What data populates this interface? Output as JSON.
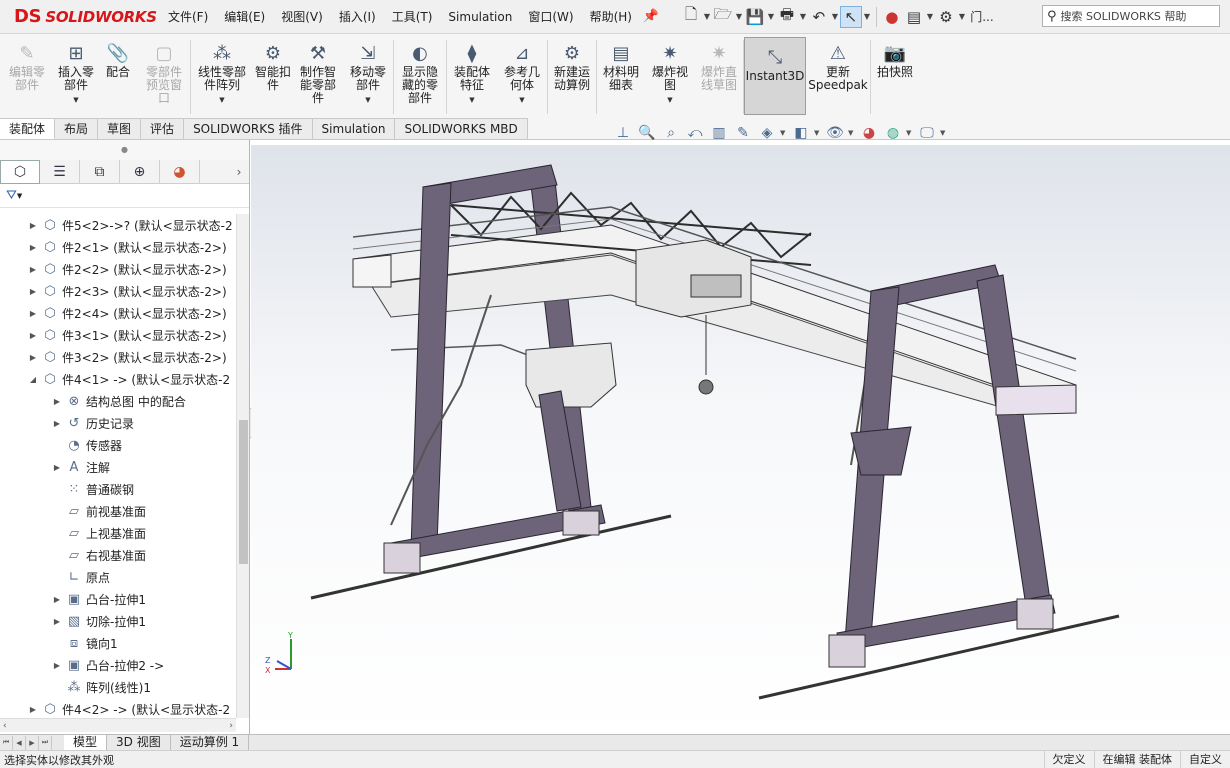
{
  "app": {
    "brand_mark": "DS",
    "brand": "SOLIDWORKS"
  },
  "menus": [
    "文件(F)",
    "编辑(E)",
    "视图(V)",
    "插入(I)",
    "工具(T)",
    "Simulation",
    "窗口(W)",
    "帮助(H)"
  ],
  "search": {
    "placeholder": "搜索 SOLIDWORKS 帮助"
  },
  "quick_access": {
    "overflow_label": "门..."
  },
  "ribbon": [
    {
      "label": "编辑零\n部件",
      "icon": "edit-component-icon",
      "disabled": true
    },
    {
      "label": "插入零\n部件",
      "icon": "insert-component-icon",
      "dropdown": true
    },
    {
      "label": "配合",
      "icon": "mate-icon"
    },
    {
      "label": "零部件\n预览窗\n口",
      "icon": "component-preview-icon",
      "disabled": true
    },
    {
      "label": "线性零部\n件阵列",
      "icon": "linear-pattern-icon",
      "dropdown": true
    },
    {
      "label": "智能扣\n件",
      "icon": "smart-fastener-icon"
    },
    {
      "label": "制作智\n能零部\n件",
      "icon": "smart-component-icon"
    },
    {
      "label": "移动零\n部件",
      "icon": "move-component-icon",
      "dropdown": true
    },
    {
      "label": "显示隐\n藏的零\n部件",
      "icon": "show-hidden-icon"
    },
    {
      "label": "装配体\n特征",
      "icon": "assembly-feature-icon",
      "dropdown": true
    },
    {
      "label": "参考几\n何体",
      "icon": "reference-geometry-icon",
      "dropdown": true
    },
    {
      "label": "新建运\n动算例",
      "icon": "motion-study-icon"
    },
    {
      "label": "材料明\n细表",
      "icon": "bom-icon"
    },
    {
      "label": "爆炸视\n图",
      "icon": "exploded-view-icon",
      "dropdown": true
    },
    {
      "label": "爆炸直\n线草图",
      "icon": "explode-line-icon",
      "disabled": true
    },
    {
      "label": "Instant3D",
      "icon": "instant3d-icon",
      "active": true
    },
    {
      "label": "更新\nSpeedpak",
      "icon": "speedpak-icon"
    },
    {
      "label": "拍快照",
      "icon": "snapshot-icon"
    }
  ],
  "command_tabs": [
    "装配体",
    "布局",
    "草图",
    "评估",
    "SOLIDWORKS 插件",
    "Simulation",
    "SOLIDWORKS MBD"
  ],
  "tree": [
    {
      "label": "件5<2>->? (默认<显示状态-2",
      "icon": "part-icon",
      "level": 0,
      "expand": "collapsed"
    },
    {
      "label": "件2<1> (默认<显示状态-2>)",
      "icon": "part-icon",
      "level": 0,
      "expand": "collapsed"
    },
    {
      "label": "件2<2> (默认<显示状态-2>)",
      "icon": "part-icon",
      "level": 0,
      "expand": "collapsed"
    },
    {
      "label": "件2<3> (默认<显示状态-2>)",
      "icon": "part-icon",
      "level": 0,
      "expand": "collapsed"
    },
    {
      "label": "件2<4> (默认<显示状态-2>)",
      "icon": "part-icon",
      "level": 0,
      "expand": "collapsed"
    },
    {
      "label": "件3<1> (默认<显示状态-2>)",
      "icon": "part-icon",
      "level": 0,
      "expand": "collapsed"
    },
    {
      "label": "件3<2> (默认<显示状态-2>)",
      "icon": "part-icon",
      "level": 0,
      "expand": "collapsed"
    },
    {
      "label": "件4<1> -> (默认<显示状态-2",
      "icon": "part-icon",
      "level": 0,
      "expand": "expanded"
    },
    {
      "label": "结构总图 中的配合",
      "icon": "mates-folder-icon",
      "level": 1,
      "expand": "collapsed"
    },
    {
      "label": "历史记录",
      "icon": "history-icon",
      "level": 1,
      "expand": "collapsed"
    },
    {
      "label": "传感器",
      "icon": "sensor-icon",
      "level": 1,
      "expand": "none"
    },
    {
      "label": "注解",
      "icon": "annotation-icon",
      "level": 1,
      "expand": "collapsed"
    },
    {
      "label": "普通碳钢",
      "icon": "material-icon",
      "level": 1,
      "expand": "none"
    },
    {
      "label": "前视基准面",
      "icon": "plane-icon",
      "level": 1,
      "expand": "none"
    },
    {
      "label": "上视基准面",
      "icon": "plane-icon",
      "level": 1,
      "expand": "none"
    },
    {
      "label": "右视基准面",
      "icon": "plane-icon",
      "level": 1,
      "expand": "none"
    },
    {
      "label": "原点",
      "icon": "origin-icon",
      "level": 1,
      "expand": "none"
    },
    {
      "label": "凸台-拉伸1",
      "icon": "extrude-icon",
      "level": 1,
      "expand": "collapsed"
    },
    {
      "label": "切除-拉伸1",
      "icon": "cut-extrude-icon",
      "level": 1,
      "expand": "collapsed"
    },
    {
      "label": "镜向1",
      "icon": "mirror-icon",
      "level": 1,
      "expand": "none"
    },
    {
      "label": "凸台-拉伸2 ->",
      "icon": "extrude-icon",
      "level": 1,
      "expand": "collapsed"
    },
    {
      "label": "阵列(线性)1",
      "icon": "linear-pattern-icon",
      "level": 1,
      "expand": "none"
    },
    {
      "label": "件4<2> -> (默认<显示状态-2",
      "icon": "part-icon",
      "level": 0,
      "expand": "collapsed"
    }
  ],
  "triad": {
    "x": "X",
    "y": "Y",
    "z": "Z"
  },
  "bottom_tabs": [
    "模型",
    "3D 视图",
    "运动算例 1"
  ],
  "status": {
    "message": "选择实体以修改其外观",
    "cells": [
      "欠定义",
      "在编辑 装配体",
      "自定义"
    ]
  },
  "colors": {
    "steel": "#6e6479",
    "deck": "#f2f2f2",
    "brand": "#d8161a"
  }
}
